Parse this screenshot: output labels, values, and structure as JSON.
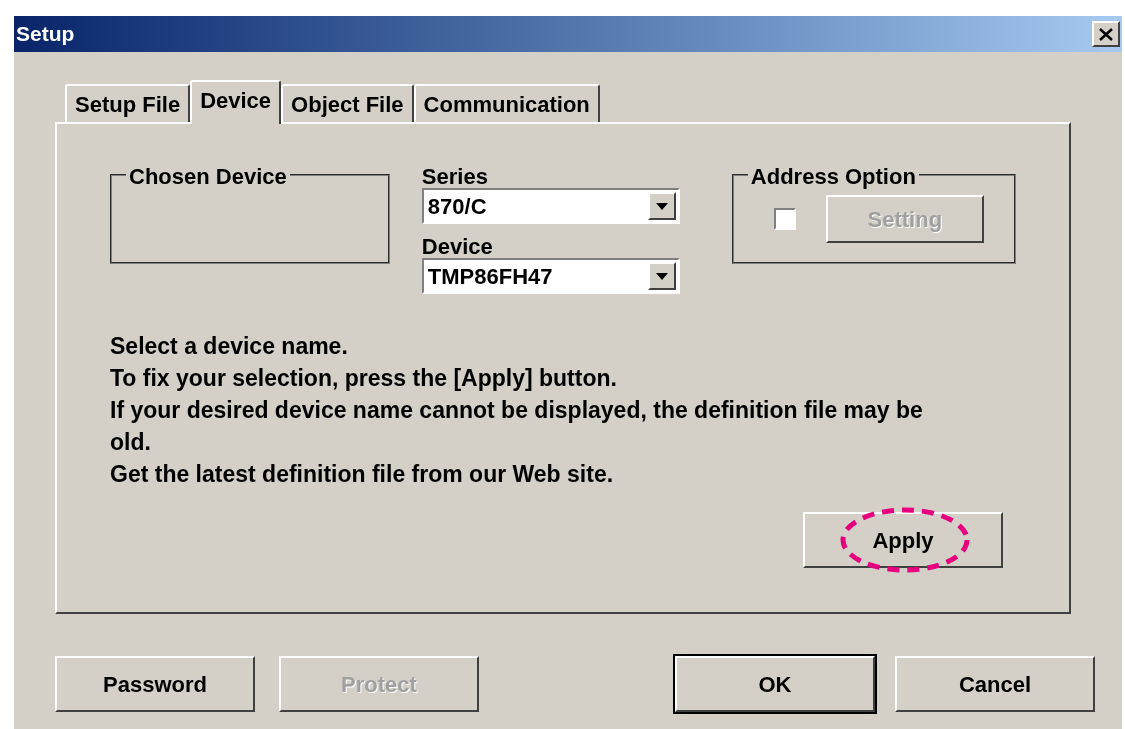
{
  "window": {
    "title": "Setup"
  },
  "tabs": [
    {
      "label": "Setup File",
      "selected": false
    },
    {
      "label": "Device",
      "selected": true
    },
    {
      "label": "Object File",
      "selected": false
    },
    {
      "label": "Communication",
      "selected": false
    }
  ],
  "chosen_device": {
    "label": "Chosen Device"
  },
  "series": {
    "label": "Series",
    "value": "870/C"
  },
  "device": {
    "label": "Device",
    "value": "TMP86FH47"
  },
  "address_option": {
    "label": "Address Option",
    "checked": false,
    "setting_button": {
      "label": "Setting",
      "disabled": true
    }
  },
  "instructions": [
    "Select a device name.",
    "To fix your selection, press the [Apply] button.",
    "If your desired device name cannot be displayed, the definition file may be old.",
    "Get the latest definition file from our Web site."
  ],
  "apply_button": {
    "label": "Apply"
  },
  "footer_buttons": [
    {
      "label": "Password",
      "disabled": false,
      "default": false
    },
    {
      "label": "Protect",
      "disabled": true,
      "default": false
    },
    {
      "label": "OK",
      "disabled": false,
      "default": true
    },
    {
      "label": "Cancel",
      "disabled": false,
      "default": false
    }
  ]
}
